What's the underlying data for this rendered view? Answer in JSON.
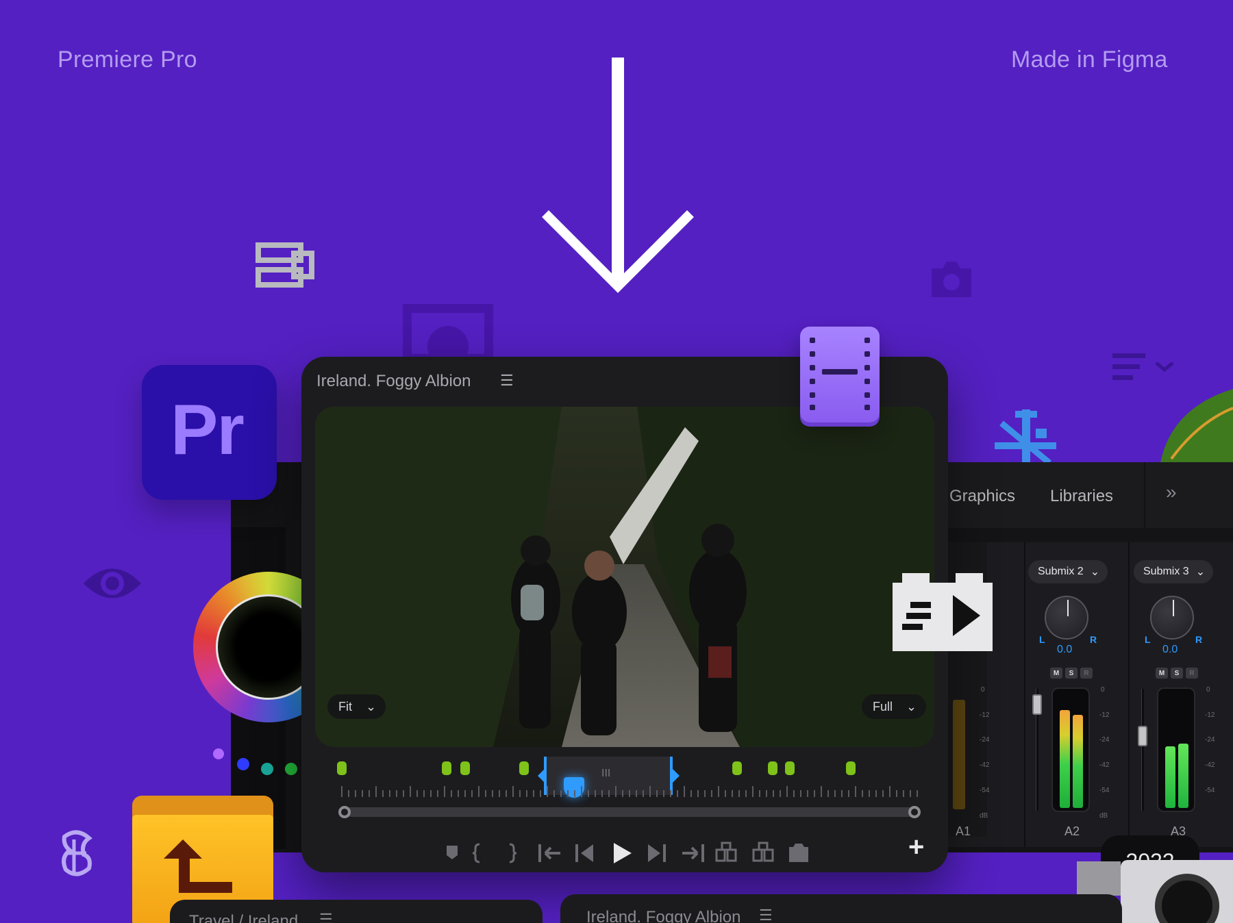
{
  "header": {
    "left_caption": "Premiere Pro",
    "right_caption": "Made in Figma"
  },
  "logo": {
    "text": "Pr"
  },
  "monitor": {
    "title": "Ireland. Foggy Albion",
    "menu_icon": "hamburger-icon",
    "zoom_select": "Fit",
    "quality_select": "Full",
    "playhead_handle_label": "III",
    "transport_icons": [
      "marker-icon",
      "mark-in-icon",
      "mark-out-icon",
      "go-to-in-icon",
      "step-back-icon",
      "play-icon",
      "step-forward-icon",
      "go-to-out-icon",
      "insert-icon",
      "overwrite-icon",
      "export-frame-icon"
    ],
    "add_button": "+"
  },
  "mixer": {
    "tabs": [
      "Graphics",
      "Libraries"
    ],
    "overflow_icon": "double-chevron-right-icon",
    "channels": [
      {
        "submix": "Submix 2",
        "pan_value": "0.0",
        "left": "L",
        "right": "R",
        "m": "M",
        "s": "S",
        "r": "R",
        "label": "A2",
        "level_left": 0.82,
        "level_right": 0.78
      },
      {
        "submix": "Submix 3",
        "pan_value": "0.0",
        "left": "L",
        "right": "R",
        "m": "M",
        "s": "S",
        "r": "R",
        "label": "A3",
        "level_left": 0.52,
        "level_right": 0.54
      }
    ],
    "scale_ticks": [
      "0",
      "-12",
      "-24",
      "-42",
      "-54",
      "dB"
    ],
    "partial_label": "A1"
  },
  "year_badge": "2022",
  "bottom_panels": {
    "left_title": "Travel / Ireland",
    "right_title": "Ireland. Foggy Albion"
  },
  "colors": {
    "background": "#5420c2",
    "panel": "#1c1c1f",
    "accent_blue": "#2f9bff",
    "marker_green": "#7ec21a",
    "logo_purple": "#9b7bff"
  }
}
